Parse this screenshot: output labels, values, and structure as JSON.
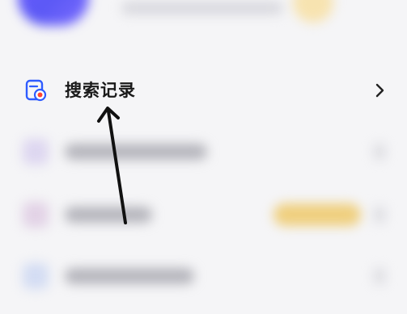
{
  "menu": {
    "search_history": {
      "label": "搜索记录",
      "icon": "search-history-icon",
      "chevron": "chevron-right-icon"
    }
  },
  "colors": {
    "accent_blue": "#2e5bff",
    "accent_red": "#ff4433",
    "label": "#1a1a1a",
    "background": "#f5f5f7",
    "annotation_arrow": "#111111"
  },
  "annotation": {
    "icon": "arrow-pointer-icon"
  }
}
